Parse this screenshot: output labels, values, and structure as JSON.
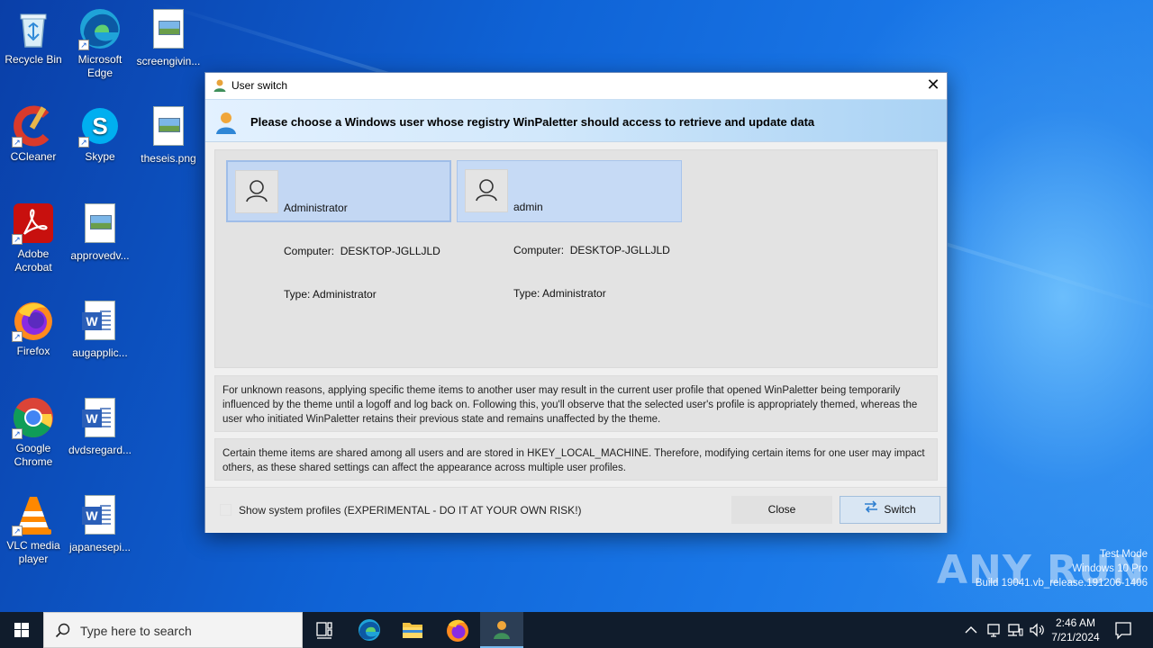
{
  "desktop": {
    "icons": [
      {
        "label": "Recycle Bin",
        "icon": "recycle-bin-icon"
      },
      {
        "label": "Microsoft Edge",
        "icon": "edge-icon"
      },
      {
        "label": "screengivin...",
        "icon": "image-file-icon"
      },
      {
        "label": "CCleaner",
        "icon": "ccleaner-icon"
      },
      {
        "label": "Skype",
        "icon": "skype-icon"
      },
      {
        "label": "theseis.png",
        "icon": "image-file-icon"
      },
      {
        "label": "Adobe Acrobat",
        "icon": "acrobat-icon"
      },
      {
        "label": "approvedv...",
        "icon": "image-file-icon"
      },
      {
        "label": "Firefox",
        "icon": "firefox-icon"
      },
      {
        "label": "augapplic...",
        "icon": "word-doc-icon"
      },
      {
        "label": "Google Chrome",
        "icon": "chrome-icon"
      },
      {
        "label": "dvdsregard...",
        "icon": "word-doc-icon"
      },
      {
        "label": "VLC media player",
        "icon": "vlc-icon"
      },
      {
        "label": "japanesepi...",
        "icon": "word-doc-icon"
      }
    ]
  },
  "dialog": {
    "title": "User switch",
    "close_glyph": "✕",
    "header_text": "Please choose a Windows user whose registry WinPaletter should access to retrieve and update data",
    "users": [
      {
        "name": "Administrator",
        "computer": "Computer:  DESKTOP-JGLLJLD",
        "type": "Type: Administrator",
        "selected": true
      },
      {
        "name": "admin",
        "computer": "Computer:  DESKTOP-JGLLJLD",
        "type": "Type: Administrator",
        "selected": false
      }
    ],
    "note1": "For unknown reasons, applying specific theme items to another user may result in the current user profile that opened WinPaletter being temporarily influenced by the theme until a logoff and log back on. Following this, you'll observe that the selected user's profile is appropriately themed, whereas the user who initiated WinPaletter retains their previous state and remains unaffected by the theme.",
    "note2": "Certain theme items are shared among all users and are stored in HKEY_LOCAL_MACHINE. Therefore, modifying certain items for one user may impact others, as these shared settings can affect the appearance across multiple user profiles.",
    "show_system_label": "Show system profiles (EXPERIMENTAL - DO IT AT YOUR OWN RISK!)",
    "close_button": "Close",
    "switch_button": "Switch"
  },
  "watermark": {
    "brand": "ANY RUN",
    "line1": "Test Mode",
    "line2": "Windows 10 Pro",
    "line3": "Build 19041.vb_release.191206-1406"
  },
  "taskbar": {
    "search_placeholder": "Type here to search",
    "time": "2:46 AM",
    "date": "7/21/2024",
    "items": [
      "task-view-icon",
      "edge-icon",
      "file-explorer-icon",
      "firefox-icon",
      "winpaletter-icon"
    ]
  },
  "colors": {
    "accent": "#0078d7",
    "header_gradient_end": "#a9d2f4",
    "card_selected": "#c3d7f3"
  }
}
